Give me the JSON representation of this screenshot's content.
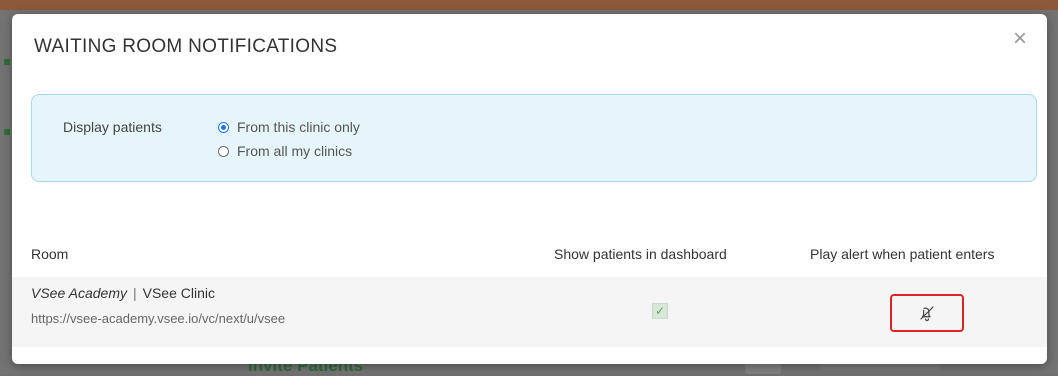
{
  "modal": {
    "title": "WAITING ROOM NOTIFICATIONS",
    "close_icon": "close-icon"
  },
  "filter": {
    "label": "Display patients",
    "options": [
      {
        "label": "From this clinic only",
        "selected": true
      },
      {
        "label": "From all my clinics",
        "selected": false
      }
    ]
  },
  "table": {
    "headers": {
      "room": "Room",
      "show": "Show patients in dashboard",
      "alert": "Play alert when patient enters"
    },
    "rows": [
      {
        "room_name": "VSee Academy",
        "separator": "|",
        "clinic": "VSee Clinic",
        "url": "https://vsee-academy.vsee.io/vc/next/u/vsee",
        "show_checked_glyph": "✓",
        "alert_icon": "bell-off-icon"
      }
    ]
  },
  "background": {
    "invite_label": "Invite Patients"
  },
  "colors": {
    "accent_blue": "#1a73e8",
    "filter_bg": "#e6f4fb",
    "highlight_red": "#e02424"
  }
}
